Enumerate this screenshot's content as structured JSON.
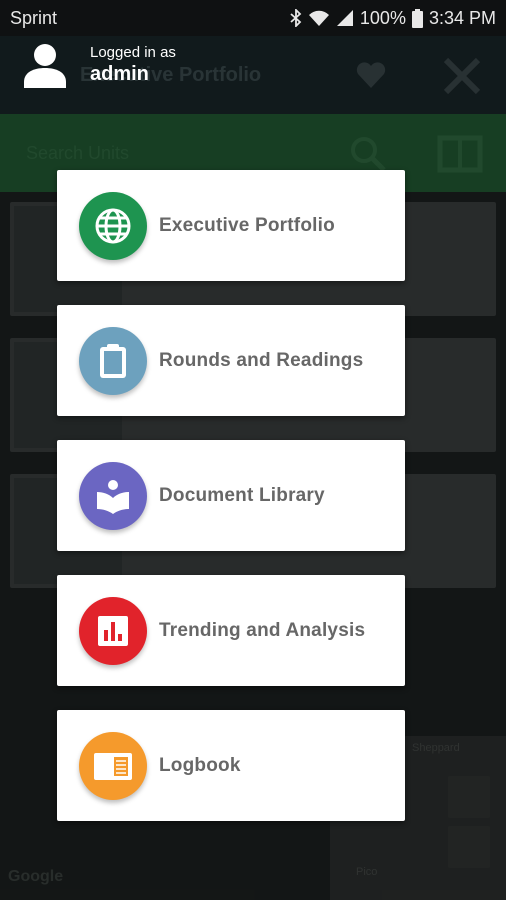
{
  "status_bar": {
    "carrier": "Sprint",
    "battery": "100%",
    "time": "3:34 PM"
  },
  "background": {
    "header_title": "Executive Portfolio",
    "search_placeholder": "Search Units",
    "map_labels": [
      "Sheppard",
      "Pico"
    ],
    "map_brand": "Google"
  },
  "user": {
    "logged_in_label": "Logged in as",
    "username": "admin"
  },
  "menu": {
    "items": [
      {
        "label": "Executive Portfolio",
        "icon": "globe-icon",
        "color": "#1e9450"
      },
      {
        "label": "Rounds and Readings",
        "icon": "clipboard-icon",
        "color": "#6da1be"
      },
      {
        "label": "Document Library",
        "icon": "book-reader-icon",
        "color": "#6b66c2"
      },
      {
        "label": "Trending and Analysis",
        "icon": "bar-chart-icon",
        "color": "#e1232b"
      },
      {
        "label": "Logbook",
        "icon": "logbook-icon",
        "color": "#f59a2c"
      }
    ]
  }
}
